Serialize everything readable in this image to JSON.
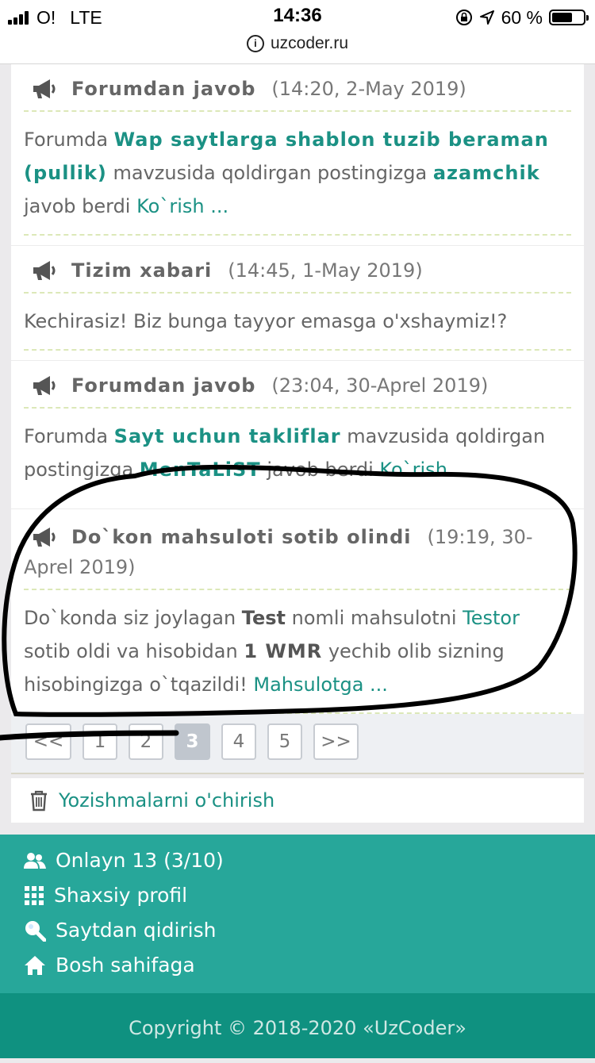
{
  "status_bar": {
    "carrier": "O!",
    "network": "LTE",
    "time": "14:36",
    "battery_percent": "60 %",
    "url": "uzcoder.ru"
  },
  "messages": [
    {
      "title": "Forumdan javob",
      "date": "(14:20, 2-May 2019)",
      "body": {
        "t1": "Forumda ",
        "topic": "Wap saytlarga shablon tuzib beraman (pullik)",
        "t2": " mavzusida qoldirgan postingizga ",
        "user": "azamchik",
        "t3": " javob berdi ",
        "link": "Ko`rish ..."
      }
    },
    {
      "title": "Tizim xabari",
      "date": "(14:45, 1-May 2019)",
      "body": {
        "text": "Kechirasiz! Biz bunga tayyor emasga o'xshaymiz!?"
      }
    },
    {
      "title": "Forumdan javob",
      "date": "(23:04, 30-Aprel 2019)",
      "body": {
        "t1": "Forumda ",
        "topic": "Sayt uchun takliflar",
        "t2": " mavzusida qoldirgan postingizga ",
        "user": "MenTaLiST",
        "t3": " javob berdi ",
        "link": "Ko`rish ..."
      }
    },
    {
      "title": "Do`kon mahsuloti sotib olindi",
      "date": "(19:19, 30-Aprel 2019)",
      "body": {
        "t1": "Do`konda siz joylagan ",
        "product": "Test",
        "t2": " nomli mahsulotni ",
        "buyer": "Testor",
        "t3": " sotib oldi va hisobidan ",
        "amount": "1 WMR",
        "t4": " yechib olib sizning hisobingizga o`tqazildi! ",
        "link": "Mahsulotga ..."
      }
    }
  ],
  "pagination": {
    "prev": "<<",
    "pages": [
      "1",
      "2",
      "3",
      "4",
      "5"
    ],
    "current": "3",
    "next": ">>"
  },
  "delete_all": "Yozishmalarni o'chirish",
  "footer_nav": {
    "online": "Onlayn 13 (3/10)",
    "profile": "Shaxsiy profil",
    "search": "Saytdan qidirish",
    "home": "Bosh sahifaga"
  },
  "copyright": "Copyright © 2018-2020 «UzCoder»",
  "colors": {
    "link": "#1b9184",
    "footer": "#27a79a",
    "copyright_bg": "#0f9180",
    "dashed": "#dce8b8"
  },
  "icons": [
    "megaphone-icon",
    "trash-icon",
    "users-icon",
    "grid-icon",
    "search-icon",
    "home-icon",
    "info-icon",
    "location-icon",
    "lock-rotation-icon"
  ]
}
